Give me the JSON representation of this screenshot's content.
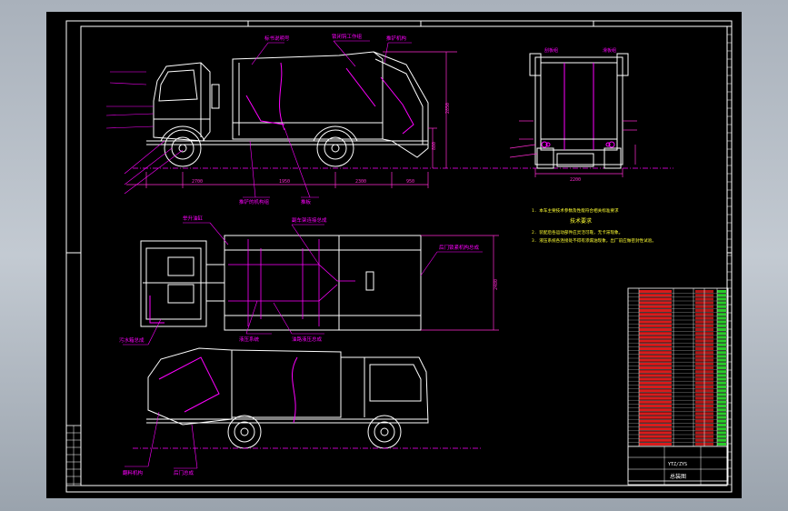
{
  "viewport": {
    "background": "#000000"
  },
  "colors": {
    "frame": "#ffffff",
    "outline": "#ffffff",
    "leader": "#ff00ff",
    "dimension": "#ff2bd1",
    "centerline": "#ff00ff",
    "note": "#ffff33",
    "table_text": "#33ff33",
    "table_fill": "#ff2020"
  },
  "dimensions": {
    "overall_height": "2850",
    "hopper_height": "880",
    "front_overhang": "2700",
    "wheelbase": "1950",
    "body_length": "2300",
    "rear_overhang": "950",
    "plan_width": "2480",
    "end_width": "2200"
  },
  "callouts": {
    "side_top_a": "标书说明号",
    "side_top_b": "锁闭钩工作组",
    "side_top_c": "推铲机构",
    "side_bottom": "推铲的机构组",
    "side_bottom_b": "推板",
    "plan_top_a": "举升油缸",
    "plan_top_b": "副车架连接总成",
    "plan_right": "后门锁紧机构总成",
    "plan_bottom_a": "液压系统",
    "plan_bottom_b": "油路液压总成",
    "plan_left": "污水箱总成",
    "rear_bottom_a": "翻料机构",
    "rear_bottom_b": "后门总成",
    "end_left": "刮板组",
    "end_right": "滑板组"
  },
  "notes": {
    "line1": "1. 本车主要技术参数及性能符合相关标准要求",
    "line2": "技术要求",
    "line3": "2. 装配后各运动部件应灵活可靠，无卡滞现象。",
    "line4": "3. 液压系统各连接处不得有渗漏油现象，出厂前应做密封性试验。"
  },
  "title_block": {
    "drawing_number": "YTZ/ZYS",
    "name": "总装图"
  }
}
